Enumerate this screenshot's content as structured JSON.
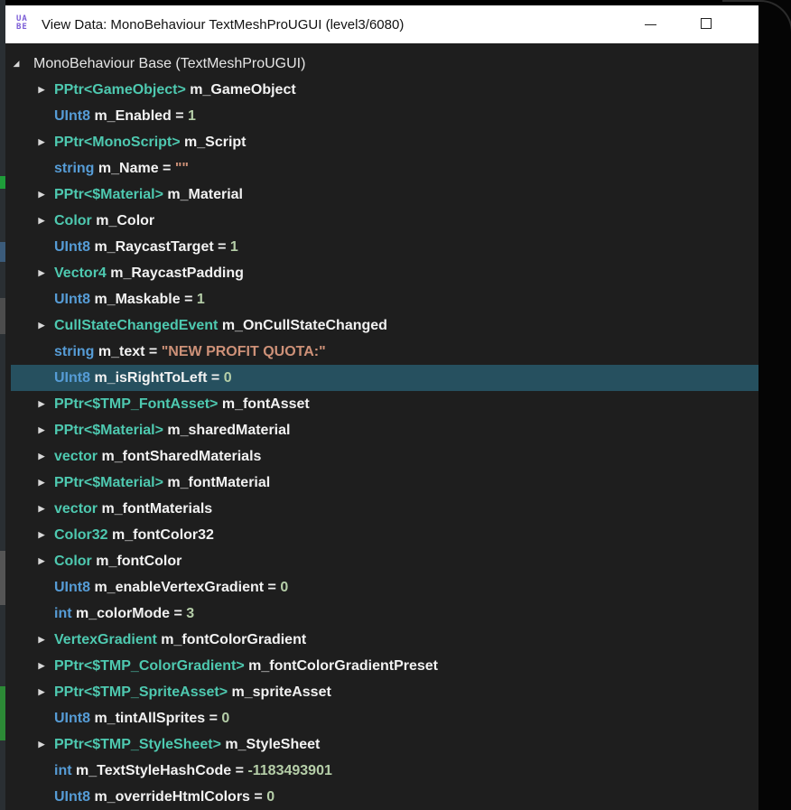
{
  "window": {
    "title": "View Data: MonoBehaviour TextMeshProUGUI (level3/6080)",
    "icon_text": "UA BE",
    "minimize_icon": "minimize-icon",
    "maximize_icon": "maximize-icon"
  },
  "colors": {
    "type": "#4ec9b0",
    "primitive": "#569cd6",
    "string": "#ce9178",
    "number": "#b5cea8",
    "selected_row": "#26505f",
    "background": "#1e1e1e"
  },
  "tree": {
    "root": {
      "label": "MonoBehaviour Base (TextMeshProUGUI)",
      "expanded": true
    },
    "selected_index": 11,
    "rows": [
      {
        "type": "PPtr<GameObject>",
        "kind": "type",
        "name": "m_GameObject",
        "expandable": true
      },
      {
        "type": "UInt8",
        "kind": "prim",
        "name": "m_Enabled",
        "value": "1",
        "value_kind": "num",
        "expandable": false
      },
      {
        "type": "PPtr<MonoScript>",
        "kind": "type",
        "name": "m_Script",
        "expandable": true
      },
      {
        "type": "string",
        "kind": "prim",
        "name": "m_Name",
        "value": "\"\"",
        "value_kind": "str",
        "expandable": false
      },
      {
        "type": "PPtr<$Material>",
        "kind": "type",
        "name": "m_Material",
        "expandable": true
      },
      {
        "type": "Color",
        "kind": "type",
        "name": "m_Color",
        "expandable": true
      },
      {
        "type": "UInt8",
        "kind": "prim",
        "name": "m_RaycastTarget",
        "value": "1",
        "value_kind": "num",
        "expandable": false
      },
      {
        "type": "Vector4",
        "kind": "type",
        "name": "m_RaycastPadding",
        "expandable": true
      },
      {
        "type": "UInt8",
        "kind": "prim",
        "name": "m_Maskable",
        "value": "1",
        "value_kind": "num",
        "expandable": false
      },
      {
        "type": "CullStateChangedEvent",
        "kind": "type",
        "name": "m_OnCullStateChanged",
        "expandable": true
      },
      {
        "type": "string",
        "kind": "prim",
        "name": "m_text",
        "value": "\"NEW PROFIT QUOTA:\"",
        "value_kind": "str",
        "expandable": false
      },
      {
        "type": "UInt8",
        "kind": "prim",
        "name": "m_isRightToLeft",
        "value": "0",
        "value_kind": "num",
        "expandable": false
      },
      {
        "type": "PPtr<$TMP_FontAsset>",
        "kind": "type",
        "name": "m_fontAsset",
        "expandable": true
      },
      {
        "type": "PPtr<$Material>",
        "kind": "type",
        "name": "m_sharedMaterial",
        "expandable": true
      },
      {
        "type": "vector",
        "kind": "type",
        "name": "m_fontSharedMaterials",
        "expandable": true
      },
      {
        "type": "PPtr<$Material>",
        "kind": "type",
        "name": "m_fontMaterial",
        "expandable": true
      },
      {
        "type": "vector",
        "kind": "type",
        "name": "m_fontMaterials",
        "expandable": true
      },
      {
        "type": "Color32",
        "kind": "type",
        "name": "m_fontColor32",
        "expandable": true
      },
      {
        "type": "Color",
        "kind": "type",
        "name": "m_fontColor",
        "expandable": true
      },
      {
        "type": "UInt8",
        "kind": "prim",
        "name": "m_enableVertexGradient",
        "value": "0",
        "value_kind": "num",
        "expandable": false
      },
      {
        "type": "int",
        "kind": "prim",
        "name": "m_colorMode",
        "value": "3",
        "value_kind": "num",
        "expandable": false
      },
      {
        "type": "VertexGradient",
        "kind": "type",
        "name": "m_fontColorGradient",
        "expandable": true
      },
      {
        "type": "PPtr<$TMP_ColorGradient>",
        "kind": "type",
        "name": "m_fontColorGradientPreset",
        "expandable": true
      },
      {
        "type": "PPtr<$TMP_SpriteAsset>",
        "kind": "type",
        "name": "m_spriteAsset",
        "expandable": true
      },
      {
        "type": "UInt8",
        "kind": "prim",
        "name": "m_tintAllSprites",
        "value": "0",
        "value_kind": "num",
        "expandable": false
      },
      {
        "type": "PPtr<$TMP_StyleSheet>",
        "kind": "type",
        "name": "m_StyleSheet",
        "expandable": true
      },
      {
        "type": "int",
        "kind": "prim",
        "name": "m_TextStyleHashCode",
        "value": "-1183493901",
        "value_kind": "num",
        "expandable": false
      },
      {
        "type": "UInt8",
        "kind": "prim",
        "name": "m_overrideHtmlColors",
        "value": "0",
        "value_kind": "num",
        "expandable": false
      }
    ]
  }
}
